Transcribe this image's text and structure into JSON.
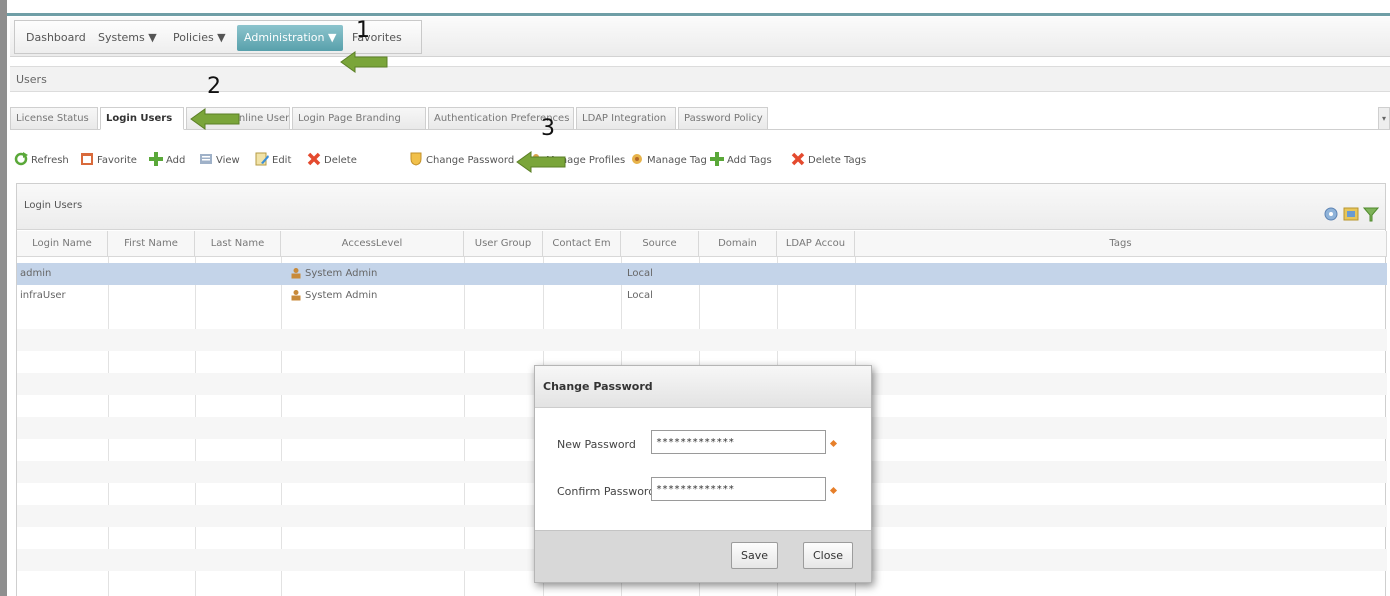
{
  "nav": {
    "items": [
      "Dashboard",
      "Systems ▼",
      "Policies ▼",
      "Administration ▼",
      "Favorites"
    ]
  },
  "section_title": "Users",
  "tabs": [
    "License Status",
    "Login Users",
    "Online Users",
    "Login Page Branding",
    "Authentication Preferences",
    "LDAP Integration",
    "Password Policy"
  ],
  "tabs_scroll_glyph": "▾",
  "toolbar": [
    {
      "label": "Refresh",
      "icon": "refresh-icon"
    },
    {
      "label": "Favorite",
      "icon": "favorite-icon"
    },
    {
      "label": "Add",
      "icon": "add-icon"
    },
    {
      "label": "View",
      "icon": "view-icon"
    },
    {
      "label": "Edit",
      "icon": "edit-icon"
    },
    {
      "label": "Delete",
      "icon": "delete-icon"
    },
    {
      "label": "Change Password",
      "icon": "shield-icon"
    },
    {
      "label": "Manage Profiles",
      "icon": "profiles-icon"
    },
    {
      "label": "Manage Tag",
      "icon": "tag-icon"
    },
    {
      "label": "Add Tags",
      "icon": "add-icon"
    },
    {
      "label": "Delete Tags",
      "icon": "delete-icon"
    }
  ],
  "grid": {
    "title": "Login Users",
    "columns": [
      "Login Name",
      "First Name",
      "Last Name",
      "AccessLevel",
      "User Group",
      "Contact Em",
      "Source",
      "Domain",
      "LDAP Accou",
      "Tags"
    ],
    "rows": [
      {
        "login": "admin",
        "access": "System Admin",
        "source": "Local"
      },
      {
        "login": "infraUser",
        "access": "System Admin",
        "source": "Local"
      }
    ]
  },
  "annotations": [
    "1",
    "2",
    "3"
  ],
  "dialog": {
    "title": "Change Password",
    "new_label": "New Password",
    "new_value": "*************",
    "confirm_label": "Confirm Password",
    "confirm_value": "*************",
    "save": "Save",
    "close": "Close"
  },
  "colors": {
    "accent": "#58a0ab",
    "selected_row": "#c4d4e9",
    "arrow_green": "#7aa53a",
    "required": "#e67f2a"
  }
}
